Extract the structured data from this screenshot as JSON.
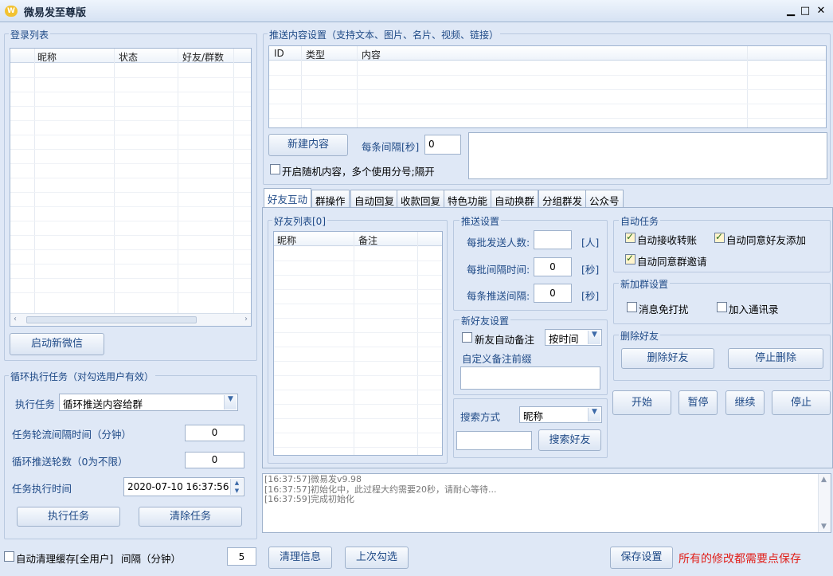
{
  "app": {
    "title": "微易发至尊版",
    "min": "▁",
    "max": "□",
    "close": "✕"
  },
  "login": {
    "group_title": "登录列表",
    "columns": [
      "昵称",
      "状态",
      "好友/群数"
    ],
    "start_button": "启动新微信"
  },
  "cycle": {
    "group_title": "循环执行任务（对勾选用户有效）",
    "task_label": "执行任务",
    "task_value": "循环推送内容给群",
    "interval_label": "任务轮流间隔时间（分钟）",
    "interval_value": "0",
    "rounds_label": "循环推送轮数（0为不限）",
    "rounds_value": "0",
    "time_label": "任务执行时间",
    "time_value": "2020-07-10 16:37:56",
    "exec_button": "执行任务",
    "clear_button": "清除任务"
  },
  "cache": {
    "label": "自动清理缓存[全用户]",
    "interval_label": "间隔（分钟）",
    "interval_value": "5"
  },
  "push": {
    "group_title": "推送内容设置（支持文本、图片、名片、视频、链接）",
    "columns": [
      "ID",
      "类型",
      "内容"
    ],
    "new_button": "新建内容",
    "each_interval_label": "每条间隔[秒]",
    "each_interval_value": "0",
    "random_label": "开启随机内容，多个使用分号;隔开"
  },
  "tabs": [
    "好友互动",
    "群操作",
    "自动回复",
    "收款回复",
    "特色功能",
    "自动换群",
    "分组群发",
    "公众号"
  ],
  "friends": {
    "group_title": "好友列表[0]",
    "columns": [
      "昵称",
      "备注"
    ]
  },
  "push_settings": {
    "group_title": "推送设置",
    "per_batch_label": "每批发送人数:",
    "per_batch_value": "",
    "per_batch_unit": "[人]",
    "batch_interval_label": "每批间隔时间:",
    "batch_interval_value": "0",
    "batch_interval_unit": "[秒]",
    "each_interval_label": "每条推送间隔:",
    "each_interval_value": "0",
    "each_interval_unit": "[秒]"
  },
  "new_friend": {
    "group_title": "新好友设置",
    "auto_remark_label": "新友自动备注",
    "remark_mode": "按时间",
    "prefix_label": "自定义备注前缀"
  },
  "search": {
    "label": "搜索方式",
    "mode": "昵称",
    "button": "搜索好友"
  },
  "auto_tasks": {
    "group_title": "自动任务",
    "auto_receive": "自动接收转账",
    "auto_accept_friend": "自动同意好友添加",
    "auto_accept_group": "自动同意群邀请"
  },
  "group_join": {
    "group_title": "新加群设置",
    "no_disturb": "消息免打扰",
    "add_contacts": "加入通讯录"
  },
  "delete_friend": {
    "group_title": "删除好友",
    "delete_button": "删除好友",
    "stop_button": "停止删除"
  },
  "actions": {
    "start": "开始",
    "pause": "暂停",
    "continue": "继续",
    "stop": "停止"
  },
  "log": [
    "[16:37:57]微易发v9.98",
    "[16:37:57]初始化中，此过程大约需要20秒，请耐心等待...",
    "[16:37:59]完成初始化"
  ],
  "bottom": {
    "clear_info": "清理信息",
    "last_checked": "上次勾选",
    "save": "保存设置",
    "save_hint": "所有的修改都需要点保存"
  },
  "colors": {
    "accent": "#1f4a87",
    "warning": "#e0201b",
    "background": "#dfe8f6"
  }
}
